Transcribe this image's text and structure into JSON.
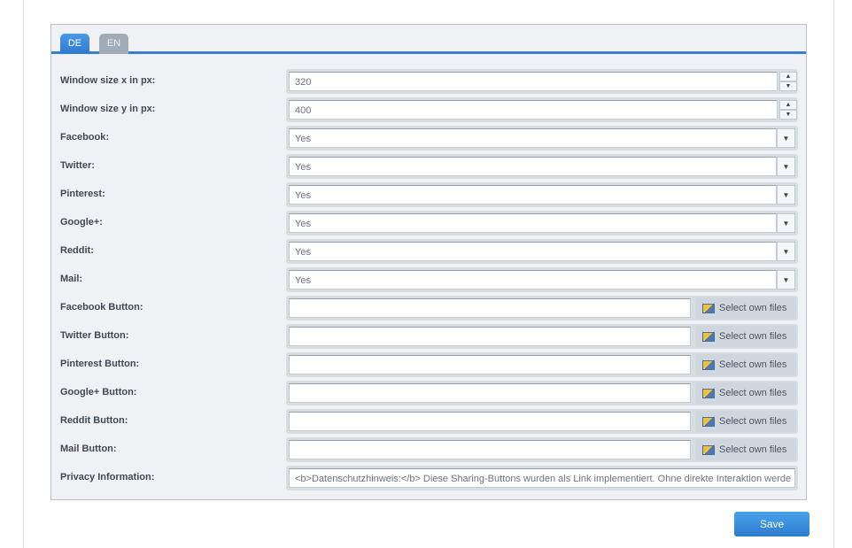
{
  "tabs": [
    {
      "label": "DE",
      "active": true
    },
    {
      "label": "EN",
      "active": false
    }
  ],
  "fields": [
    {
      "label": "Window size x in px:",
      "type": "number",
      "value": "320"
    },
    {
      "label": "Window size y in px:",
      "type": "number",
      "value": "400"
    },
    {
      "label": "Facebook:",
      "type": "select",
      "value": "Yes"
    },
    {
      "label": "Twitter:",
      "type": "select",
      "value": "Yes"
    },
    {
      "label": "Pinterest:",
      "type": "select",
      "value": "Yes"
    },
    {
      "label": "Google+:",
      "type": "select",
      "value": "Yes"
    },
    {
      "label": "Reddit:",
      "type": "select",
      "value": "Yes"
    },
    {
      "label": "Mail:",
      "type": "select",
      "value": "Yes"
    },
    {
      "label": "Facebook Button:",
      "type": "file",
      "value": "",
      "button": "Select own files"
    },
    {
      "label": "Twitter Button:",
      "type": "file",
      "value": "",
      "button": "Select own files"
    },
    {
      "label": "Pinterest Button:",
      "type": "file",
      "value": "",
      "button": "Select own files"
    },
    {
      "label": "Google+ Button:",
      "type": "file",
      "value": "",
      "button": "Select own files"
    },
    {
      "label": "Reddit Button:",
      "type": "file",
      "value": "",
      "button": "Select own files"
    },
    {
      "label": "Mail Button:",
      "type": "file",
      "value": "",
      "button": "Select own files"
    },
    {
      "label": "Privacy Information:",
      "type": "text",
      "value": "<b>Datenschutzhinweis:</b> Diese Sharing-Buttons wurden als Link implementiert. Ohne direkte Interaktion werde"
    }
  ],
  "save_label": "Save",
  "colors": {
    "accent": "#3a7fcf"
  }
}
